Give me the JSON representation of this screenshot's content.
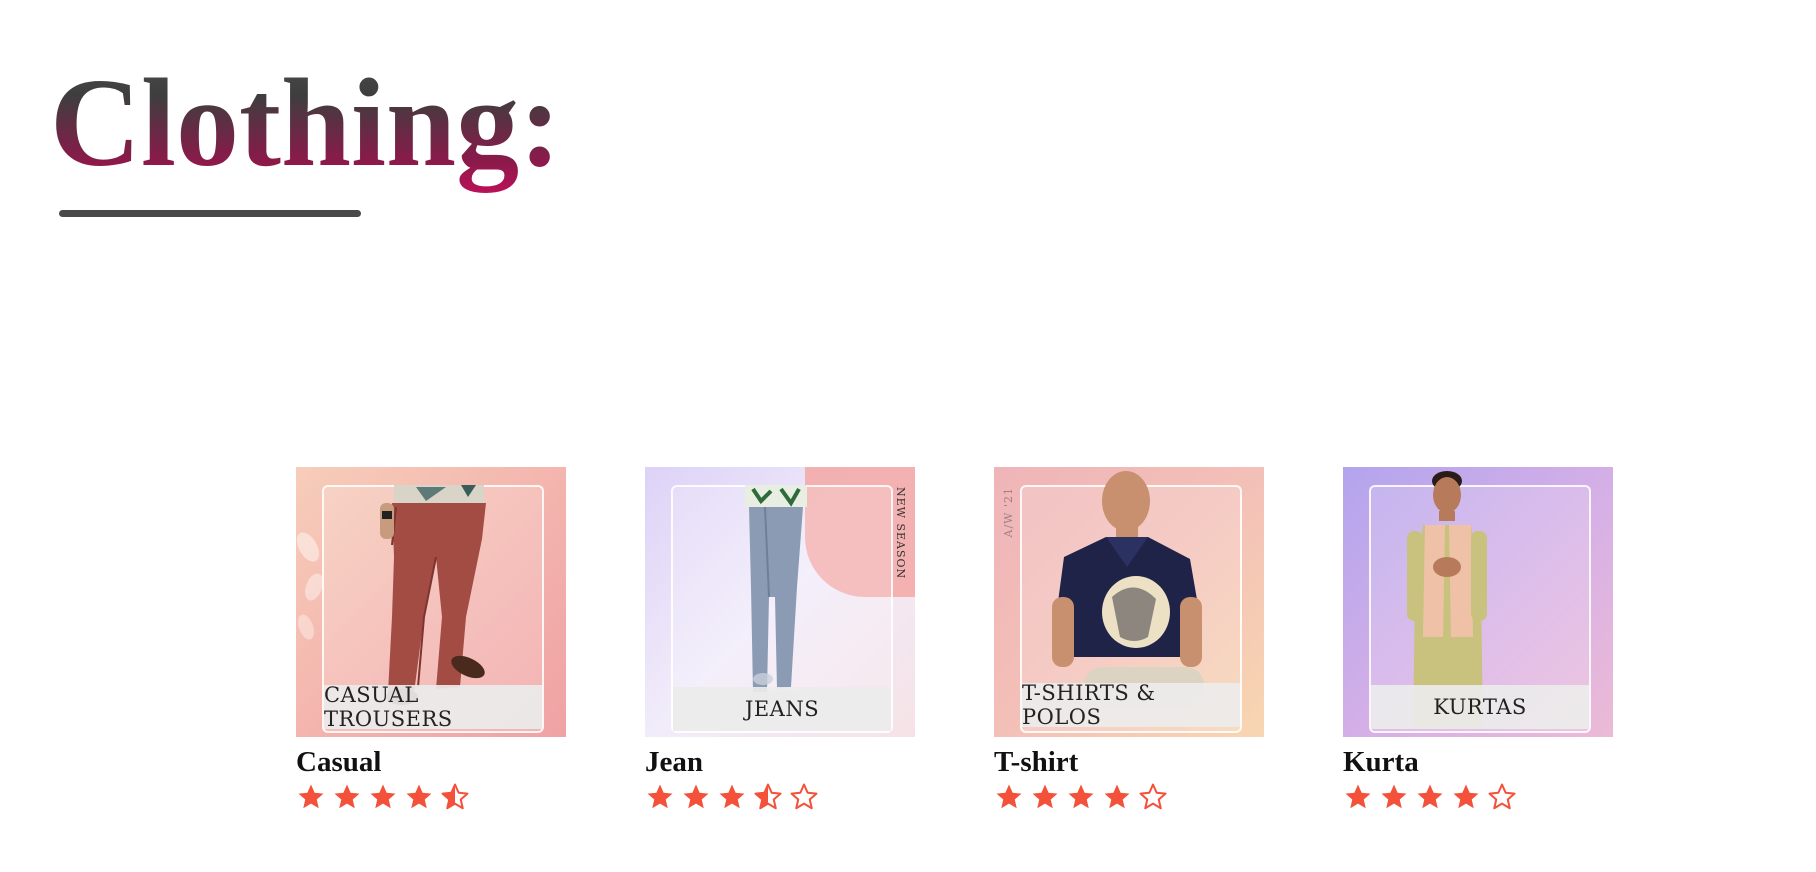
{
  "page": {
    "title": "Clothing:"
  },
  "colors": {
    "star": "#f4513a",
    "title_gradient_top": "#4d4d4d",
    "title_gradient_bottom": "#c0105a",
    "underline": "#4a4a4a"
  },
  "products": [
    {
      "name": "Casual",
      "banner": "CASUAL TROUSERS",
      "rating": 4.5,
      "max_rating": 5,
      "background": [
        "#f6c6b6",
        "#f2a7a7"
      ],
      "image_icon": "brown-trousers-model"
    },
    {
      "name": "Jean",
      "banner": "JEANS",
      "side_text": "NEW SEASON",
      "rating": 3.5,
      "max_rating": 5,
      "background": [
        "#e3dcf6",
        "#f4e4ee"
      ],
      "image_icon": "blue-jeans-model"
    },
    {
      "name": "T-shirt",
      "banner": "T-SHIRTS & POLOS",
      "side_text": "A/W '21",
      "rating": 4,
      "max_rating": 5,
      "background": [
        "#f0b8ba",
        "#f7d1b0"
      ],
      "image_icon": "navy-polo-tshirt-model"
    },
    {
      "name": "Kurta",
      "banner": "KURTAS",
      "rating": 4,
      "max_rating": 5,
      "background": [
        "#b7a7ee",
        "#e8b6d8"
      ],
      "image_icon": "kurta-nehru-jacket-model"
    }
  ]
}
